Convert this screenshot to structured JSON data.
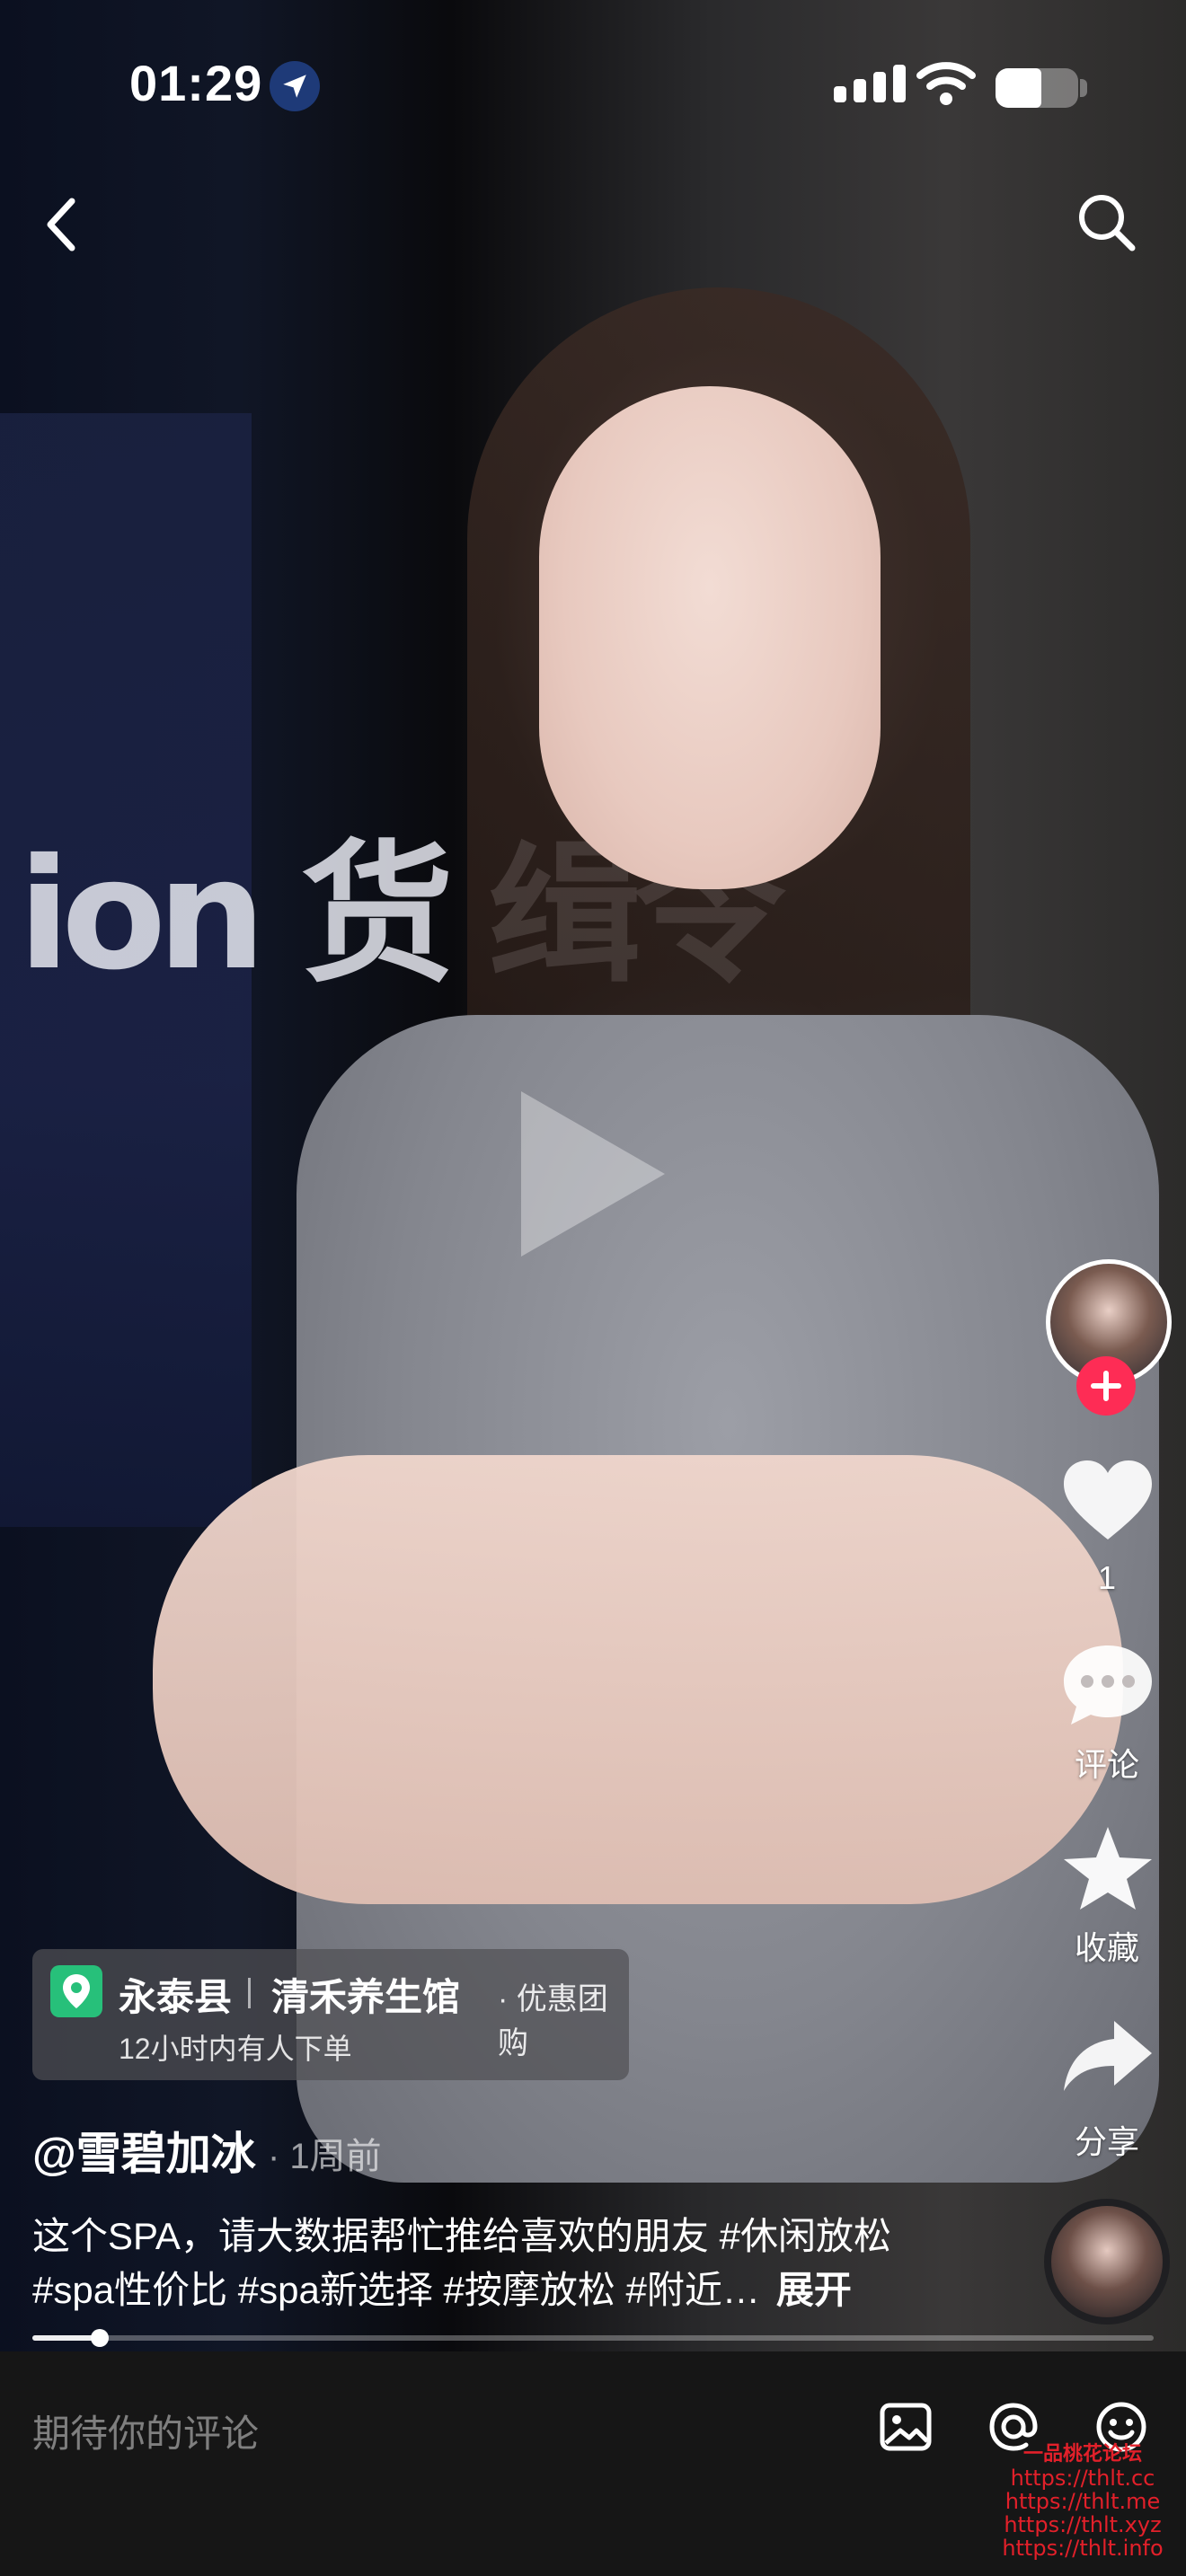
{
  "status_bar": {
    "time": "01:29",
    "battery_level_percent": 55
  },
  "header": {
    "back_icon": "chevron-left-icon",
    "search_icon": "search-icon"
  },
  "video": {
    "banner_text": "ion 货 缉令",
    "progress_percent": 6
  },
  "actions": {
    "like_count": "1",
    "comment_label": "评论",
    "favorite_label": "收藏",
    "share_label": "分享"
  },
  "poi": {
    "city": "永泰县",
    "shop": "清禾养生馆",
    "tag": "· 优惠团购",
    "subtitle": "12小时内有人下单"
  },
  "post": {
    "author": "@雪碧加冰",
    "time": "· 1周前",
    "caption_line1": "这个SPA，请大数据帮忙推给喜欢的朋友 #休闲放松",
    "caption_line2": "#spa性价比 #spa新选择 #按摩放松 #附近…",
    "expand_label": "展开"
  },
  "comment_bar": {
    "placeholder": "期待你的评论"
  },
  "watermark": {
    "title": "一品桃花论坛",
    "urls": [
      "https://thlt.cc",
      "https://thlt.me",
      "https://thlt.xyz",
      "https://thlt.info"
    ]
  },
  "colors": {
    "follow_red": "#fe2c55",
    "poi_green": "#27c07a",
    "comment_bar_bg": "#161616"
  }
}
